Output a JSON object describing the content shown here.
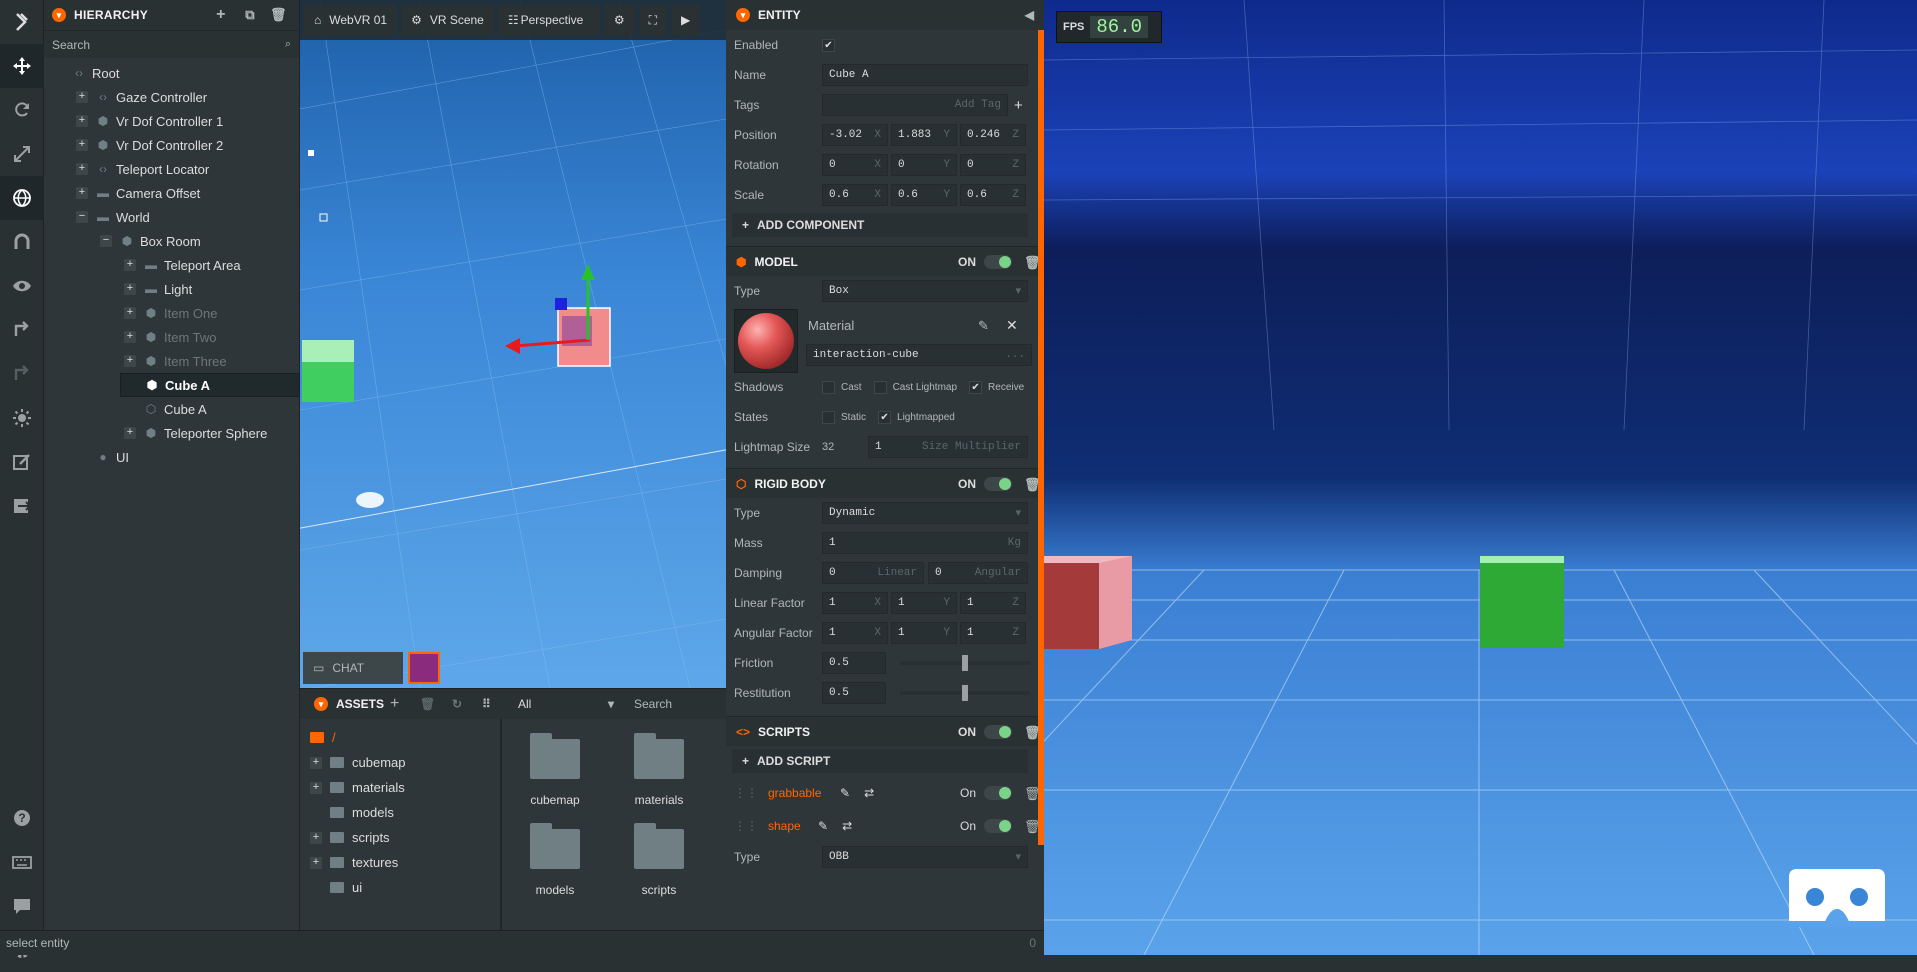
{
  "colors": {
    "accent": "#ff6600",
    "toggle_on": "#7bd389",
    "fps_text": "#9ff5a0"
  },
  "toolbar": {
    "icons": [
      "logo-icon",
      "move-icon",
      "rotate-icon",
      "scale-icon",
      "world-icon",
      "magnet-icon",
      "eye-icon",
      "redo-icon",
      "undo-icon",
      "light-icon",
      "edit-icon",
      "export-icon",
      "help-icon",
      "keyboard-icon",
      "feedback-icon",
      "settings-icon"
    ]
  },
  "hierarchy": {
    "title": "HIERARCHY",
    "search_placeholder": "Search",
    "items": [
      {
        "label": "Root",
        "indent": 0,
        "exp": "",
        "ico": "<>"
      },
      {
        "label": "Gaze Controller",
        "indent": 1,
        "exp": "+",
        "ico": "<>"
      },
      {
        "label": "Vr Dof Controller 1",
        "indent": 1,
        "exp": "+",
        "ico": "cube"
      },
      {
        "label": "Vr Dof Controller 2",
        "indent": 1,
        "exp": "+",
        "ico": "cube"
      },
      {
        "label": "Teleport Locator",
        "indent": 1,
        "exp": "+",
        "ico": "<>"
      },
      {
        "label": "Camera Offset",
        "indent": 1,
        "exp": "+",
        "ico": "folder"
      },
      {
        "label": "World",
        "indent": 1,
        "exp": "-",
        "ico": "folder"
      },
      {
        "label": "Box Room",
        "indent": 2,
        "exp": "-",
        "ico": "cube"
      },
      {
        "label": "Teleport Area",
        "indent": 3,
        "exp": "+",
        "ico": "folder"
      },
      {
        "label": "Light",
        "indent": 3,
        "exp": "+",
        "ico": "folder"
      },
      {
        "label": "Item One",
        "indent": 3,
        "exp": "+",
        "ico": "cube",
        "disabled": true
      },
      {
        "label": "Item Two",
        "indent": 3,
        "exp": "+",
        "ico": "cube",
        "disabled": true
      },
      {
        "label": "Item Three",
        "indent": 3,
        "exp": "+",
        "ico": "cube",
        "disabled": true
      },
      {
        "label": "Cube A",
        "indent": 3,
        "exp": "",
        "ico": "cube",
        "selected": true
      },
      {
        "label": "Cube A",
        "indent": 3,
        "exp": "",
        "ico": "cube-outline"
      },
      {
        "label": "Teleporter Sphere",
        "indent": 3,
        "exp": "+",
        "ico": "cube"
      },
      {
        "label": "UI",
        "indent": 1,
        "exp": "",
        "ico": "circle"
      }
    ]
  },
  "viewport": {
    "scene_tab": "WebVR 01",
    "settings_tab": "VR Scene",
    "camera": "Perspective"
  },
  "chat": {
    "label": "CHAT"
  },
  "assets": {
    "title": "ASSETS",
    "filter": "All",
    "search_placeholder": "Search",
    "root": "/",
    "tree": [
      {
        "label": "cubemap",
        "exp": "+"
      },
      {
        "label": "materials",
        "exp": "+"
      },
      {
        "label": "models",
        "exp": ""
      },
      {
        "label": "scripts",
        "exp": "+"
      },
      {
        "label": "textures",
        "exp": "+"
      },
      {
        "label": "ui",
        "exp": ""
      }
    ],
    "grid": [
      "cubemap",
      "materials",
      "models",
      "scripts"
    ]
  },
  "inspector": {
    "entity": {
      "title": "ENTITY",
      "enabled_label": "Enabled",
      "name_label": "Name",
      "name": "Cube A",
      "tags_label": "Tags",
      "tags_placeholder": "Add Tag",
      "position_label": "Position",
      "position": [
        "-3.02",
        "1.883",
        "0.246"
      ],
      "rotation_label": "Rotation",
      "rotation": [
        "0",
        "0",
        "0"
      ],
      "scale_label": "Scale",
      "scale": [
        "0.6",
        "0.6",
        "0.6"
      ],
      "axes": [
        "X",
        "Y",
        "Z"
      ],
      "add_component": "ADD COMPONENT"
    },
    "model": {
      "title": "MODEL",
      "on": "ON",
      "type_label": "Type",
      "type": "Box",
      "material_label": "Material",
      "material": "interaction-cube",
      "material_more": "...",
      "shadows_label": "Shadows",
      "cast": "Cast",
      "cast_lightmap": "Cast Lightmap",
      "receive": "Receive",
      "states_label": "States",
      "static": "Static",
      "lightmapped": "Lightmapped",
      "lightmap_size_label": "Lightmap Size",
      "lightmap_size": "32",
      "size_multiplier": "1",
      "size_multiplier_placeholder": "Size Multiplier"
    },
    "rigidbody": {
      "title": "RIGID BODY",
      "on": "ON",
      "type_label": "Type",
      "type": "Dynamic",
      "mass_label": "Mass",
      "mass": "1",
      "mass_unit": "Kg",
      "damping_label": "Damping",
      "damping_linear": "0",
      "damping_linear_unit": "Linear",
      "damping_angular": "0",
      "damping_angular_unit": "Angular",
      "linear_factor_label": "Linear Factor",
      "linear_factor": [
        "1",
        "1",
        "1"
      ],
      "angular_factor_label": "Angular Factor",
      "angular_factor": [
        "1",
        "1",
        "1"
      ],
      "friction_label": "Friction",
      "friction": "0.5",
      "restitution_label": "Restitution",
      "restitution": "0.5"
    },
    "scripts": {
      "title": "SCRIPTS",
      "on": "ON",
      "add_script": "ADD SCRIPT",
      "items": [
        {
          "name": "grabbable",
          "state": "On"
        },
        {
          "name": "shape",
          "state": "On"
        }
      ],
      "type_label": "Type",
      "type": "OBB"
    }
  },
  "game": {
    "fps_label": "FPS",
    "fps": "86.0"
  },
  "status": {
    "text": "select entity",
    "count": "0"
  }
}
